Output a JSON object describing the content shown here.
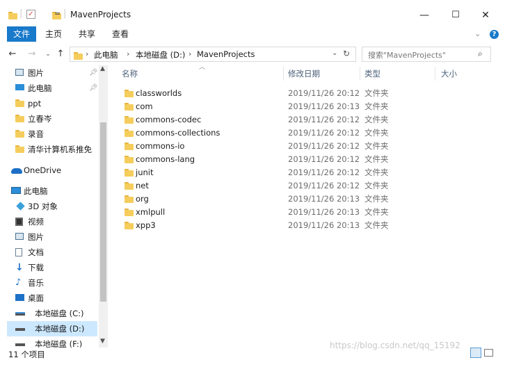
{
  "window": {
    "title": "MavenProjects",
    "quick_access_separator": "|",
    "quick_access_dropdown": "=",
    "controls": {
      "minimize": "—",
      "maximize": "☐",
      "close": "✕"
    }
  },
  "ribbon": {
    "tabs": [
      {
        "label": "文件",
        "active": true
      },
      {
        "label": "主页"
      },
      {
        "label": "共享"
      },
      {
        "label": "查看"
      }
    ]
  },
  "address": {
    "segments": [
      "此电脑",
      "本地磁盘 (D:)",
      "MavenProjects"
    ],
    "search_placeholder": "搜索\"MavenProjects\""
  },
  "nav": {
    "items": [
      {
        "label": "图片",
        "icon": "pictures-icon",
        "pinned": true
      },
      {
        "label": "此电脑",
        "icon": "computer-icon",
        "pinned": true
      },
      {
        "label": "ppt",
        "icon": "folder-icon"
      },
      {
        "label": "立春岑",
        "icon": "folder-icon"
      },
      {
        "label": "录音",
        "icon": "folder-icon"
      },
      {
        "label": "清华计算机系推免",
        "icon": "folder-icon"
      },
      {
        "label": "OneDrive",
        "icon": "onedrive-icon"
      },
      {
        "label": "此电脑",
        "icon": "computer-icon"
      },
      {
        "label": "3D 对象",
        "icon": "3d-objects-icon"
      },
      {
        "label": "视频",
        "icon": "videos-icon"
      },
      {
        "label": "图片",
        "icon": "pictures-icon"
      },
      {
        "label": "文档",
        "icon": "documents-icon"
      },
      {
        "label": "下载",
        "icon": "downloads-icon"
      },
      {
        "label": "音乐",
        "icon": "music-icon"
      },
      {
        "label": "桌面",
        "icon": "desktop-icon"
      },
      {
        "label": "本地磁盘 (C:)",
        "icon": "drive-icon"
      },
      {
        "label": "本地磁盘 (D:)",
        "icon": "drive-icon",
        "selected": true
      },
      {
        "label": "本地磁盘 (F:)",
        "icon": "drive-icon"
      }
    ]
  },
  "columns": [
    "名称",
    "修改日期",
    "类型",
    "大小"
  ],
  "files": [
    {
      "name": "classworlds",
      "date": "2019/11/26 20:12",
      "type": "文件夹"
    },
    {
      "name": "com",
      "date": "2019/11/26 20:13",
      "type": "文件夹"
    },
    {
      "name": "commons-codec",
      "date": "2019/11/26 20:12",
      "type": "文件夹"
    },
    {
      "name": "commons-collections",
      "date": "2019/11/26 20:12",
      "type": "文件夹"
    },
    {
      "name": "commons-io",
      "date": "2019/11/26 20:12",
      "type": "文件夹"
    },
    {
      "name": "commons-lang",
      "date": "2019/11/26 20:12",
      "type": "文件夹"
    },
    {
      "name": "junit",
      "date": "2019/11/26 20:12",
      "type": "文件夹"
    },
    {
      "name": "net",
      "date": "2019/11/26 20:12",
      "type": "文件夹"
    },
    {
      "name": "org",
      "date": "2019/11/26 20:13",
      "type": "文件夹"
    },
    {
      "name": "xmlpull",
      "date": "2019/11/26 20:13",
      "type": "文件夹"
    },
    {
      "name": "xpp3",
      "date": "2019/11/26 20:13",
      "type": "文件夹"
    }
  ],
  "status": {
    "count": "11 个项目"
  },
  "watermark": "https://blog.csdn.net/qq_15192",
  "colors": {
    "accent": "#1979ca",
    "selection": "#cce8ff",
    "folder": "#f5cd5c"
  }
}
